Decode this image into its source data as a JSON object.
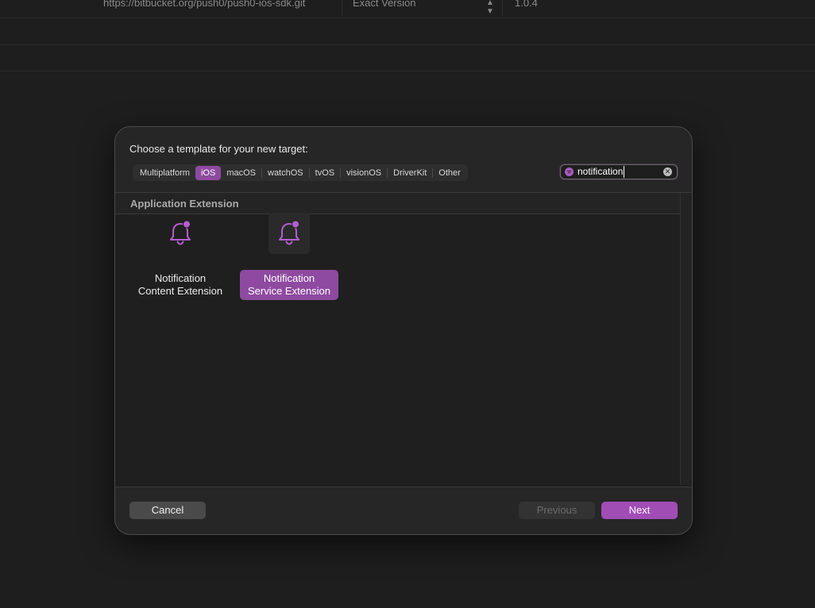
{
  "background": {
    "url": "https://bitbucket.org/push0/push0-ios-sdk.git",
    "rule": "Exact Version",
    "version": "1.0.4",
    "stepper_icon": "up-down-chevron-icon"
  },
  "sheet": {
    "title": "Choose a template for your new target:",
    "tabs": [
      {
        "label": "Multiplatform",
        "selected": false
      },
      {
        "label": "iOS",
        "selected": true
      },
      {
        "label": "macOS",
        "selected": false
      },
      {
        "label": "watchOS",
        "selected": false
      },
      {
        "label": "tvOS",
        "selected": false
      },
      {
        "label": "visionOS",
        "selected": false
      },
      {
        "label": "DriverKit",
        "selected": false
      },
      {
        "label": "Other",
        "selected": false
      }
    ],
    "search": {
      "value": "notification",
      "filter_icon": "filter-icon",
      "clear_icon": "clear-icon"
    },
    "section": {
      "label": "Application Extension",
      "templates": [
        {
          "line1": "Notification",
          "line2": "Content Extension",
          "icon": "bell-badge-icon",
          "selected": false
        },
        {
          "line1": "Notification",
          "line2": "Service Extension",
          "icon": "bell-badge-icon",
          "selected": true
        }
      ]
    },
    "footer": {
      "cancel": "Cancel",
      "previous": "Previous",
      "next": "Next"
    }
  },
  "colors": {
    "accent": "#a04db6",
    "selected_tab": "#8e4aa0",
    "icon": "#b35fcf"
  }
}
